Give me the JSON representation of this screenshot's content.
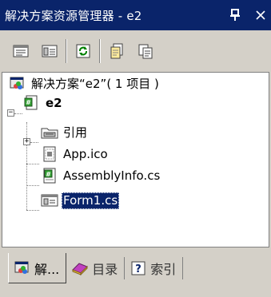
{
  "window": {
    "title": "解决方案资源管理器 - e2",
    "pin_icon": "pin-icon",
    "close_icon": "close-icon"
  },
  "toolbar": {
    "buttons": [
      {
        "name": "properties-icon"
      },
      {
        "name": "show-all-files-icon"
      },
      {
        "name": "refresh-icon"
      },
      {
        "name": "view-code-icon"
      },
      {
        "name": "view-designer-icon"
      }
    ]
  },
  "tree": {
    "solution": {
      "label": "解决方案“e2”( 1 项目 )",
      "icon": "solution-icon"
    },
    "project": {
      "label": "e2",
      "icon": "csharp-project-icon",
      "expander": "−"
    },
    "items": [
      {
        "label": "引用",
        "icon": "references-folder-icon",
        "expander": "+"
      },
      {
        "label": "App.ico",
        "icon": "ico-file-icon"
      },
      {
        "label": "AssemblyInfo.cs",
        "icon": "cs-file-icon"
      },
      {
        "label": "Form1.cs",
        "icon": "form-file-icon",
        "selected": true
      }
    ]
  },
  "tabs": [
    {
      "label": "解...",
      "icon": "solution-explorer-icon",
      "active": true
    },
    {
      "label": "目录",
      "icon": "contents-book-icon",
      "active": false
    },
    {
      "label": "索引",
      "icon": "index-help-icon",
      "active": false
    }
  ],
  "colors": {
    "titlebar": "#0a246a",
    "selection": "#0a246a",
    "chrome": "#d4d0c8"
  }
}
